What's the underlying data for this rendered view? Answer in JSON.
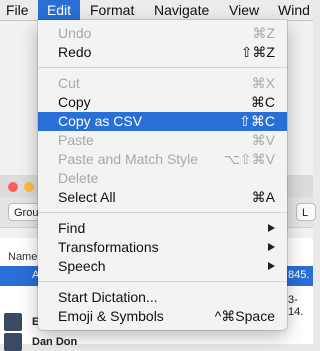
{
  "menubar": {
    "items": [
      {
        "label": "File"
      },
      {
        "label": "Edit"
      },
      {
        "label": "Format"
      },
      {
        "label": "Navigate"
      },
      {
        "label": "View"
      },
      {
        "label": "Wind"
      }
    ]
  },
  "edit_menu": {
    "undo": {
      "label": "Undo",
      "shortcut": "⌘Z"
    },
    "redo": {
      "label": "Redo",
      "shortcut": "⇧⌘Z"
    },
    "cut": {
      "label": "Cut",
      "shortcut": "⌘X"
    },
    "copy": {
      "label": "Copy",
      "shortcut": "⌘C"
    },
    "copy_csv": {
      "label": "Copy as CSV",
      "shortcut": "⇧⌘C"
    },
    "paste": {
      "label": "Paste",
      "shortcut": "⌘V"
    },
    "paste_match": {
      "label": "Paste and Match Style",
      "shortcut": "⌥⇧⌘V"
    },
    "delete": {
      "label": "Delete"
    },
    "select_all": {
      "label": "Select All",
      "shortcut": "⌘A"
    },
    "find": {
      "label": "Find"
    },
    "transformations": {
      "label": "Transformations"
    },
    "speech": {
      "label": "Speech"
    },
    "dictation": {
      "label": "Start Dictation..."
    },
    "emoji": {
      "label": "Emoji & Symbols",
      "shortcut": "^⌘Space"
    }
  },
  "background": {
    "toolbar_left": "Grou",
    "toolbar_right": "L",
    "list_header": "Name",
    "row1_left": "A",
    "row1_right": "845.",
    "row2_right": "3-14.",
    "row3_left": "E",
    "row4_left": "Dan Don"
  },
  "colors": {
    "accent": "#2a6fd6",
    "menu_bg": "#f3f3f3",
    "disabled_text": "#a9a9a9"
  }
}
